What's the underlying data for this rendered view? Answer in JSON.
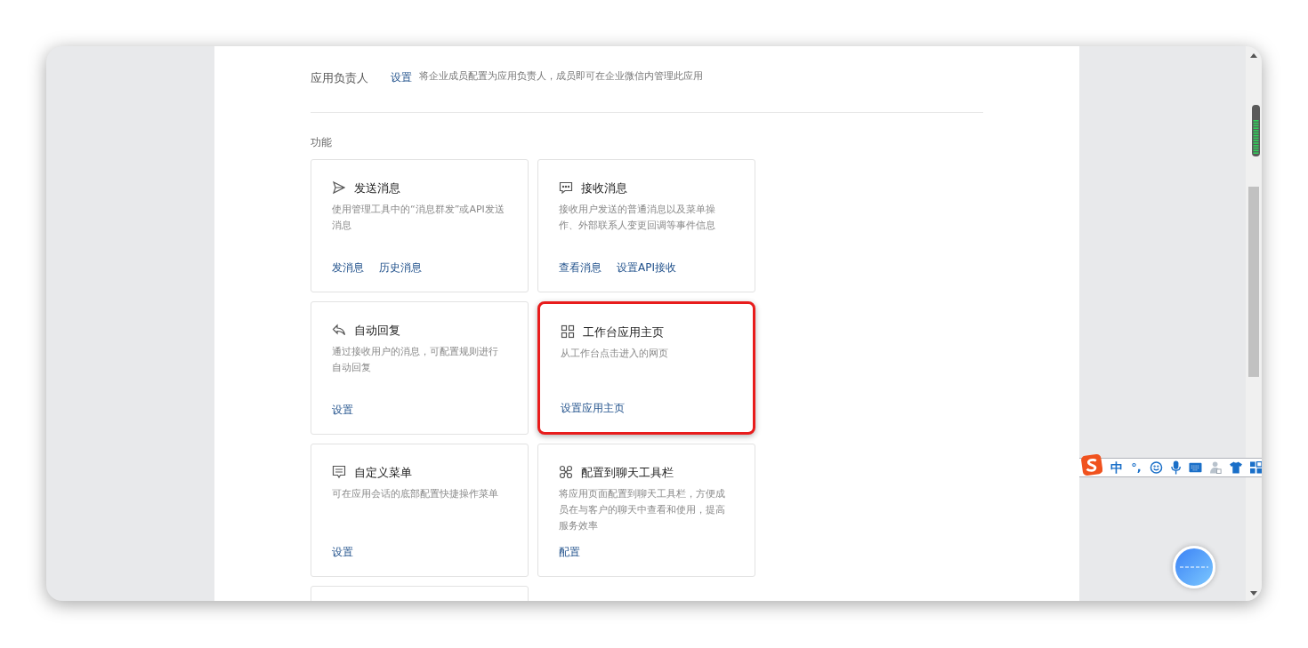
{
  "owner_row": {
    "label": "应用负责人",
    "link": "设置",
    "hint": "将企业成员配置为应用负责人，成员即可在企业微信内管理此应用"
  },
  "section_title": "功能",
  "cards": [
    {
      "kind": "send",
      "title": "发送消息",
      "desc": "使用管理工具中的“消息群发”或API发送消息",
      "actions": [
        "发消息",
        "历史消息"
      ],
      "highlighted": false
    },
    {
      "kind": "receive",
      "title": "接收消息",
      "desc": "接收用户发送的普通消息以及菜单操作、外部联系人变更回调等事件信息",
      "actions": [
        "查看消息",
        "设置API接收"
      ],
      "highlighted": false
    },
    {
      "kind": "reply",
      "title": "自动回复",
      "desc": "通过接收用户的消息，可配置规则进行自动回复",
      "actions": [
        "设置"
      ],
      "highlighted": false
    },
    {
      "kind": "grid",
      "title": "工作台应用主页",
      "desc": "从工作台点击进入的网页",
      "actions": [
        "设置应用主页"
      ],
      "highlighted": true
    },
    {
      "kind": "menu",
      "title": "自定义菜单",
      "desc": "可在应用会话的底部配置快捷操作菜单",
      "actions": [
        "设置"
      ],
      "highlighted": false
    },
    {
      "kind": "toolbar",
      "title": "配置到聊天工具栏",
      "desc": "将应用页面配置到聊天工具栏，方便成员在与客户的聊天中查看和使用，提高服务效率",
      "actions": [
        "配置"
      ],
      "highlighted": false
    }
  ],
  "ime_toolbar": {
    "language": "中",
    "punctuation": "°,"
  }
}
